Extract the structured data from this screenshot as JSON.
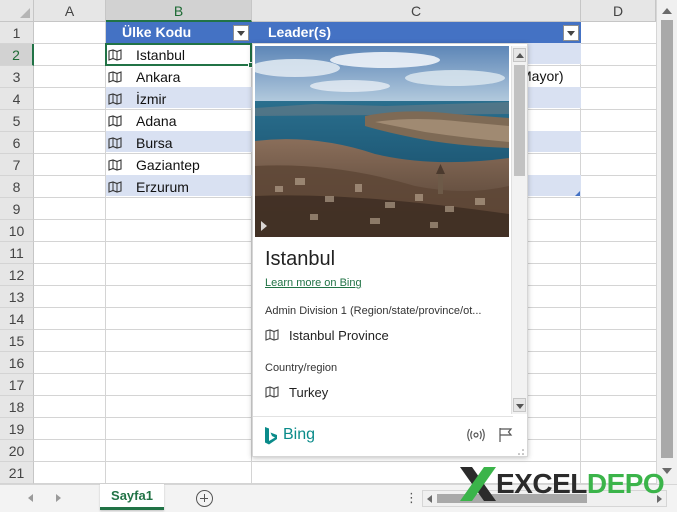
{
  "columns": [
    "A",
    "B",
    "C",
    "D"
  ],
  "rows": [
    "1",
    "2",
    "3",
    "4",
    "5",
    "6",
    "7",
    "8",
    "9",
    "10",
    "11",
    "12",
    "13",
    "14",
    "15",
    "16",
    "17",
    "18",
    "19",
    "20",
    "21"
  ],
  "table": {
    "header_b": "Ülke Kodu",
    "header_c": "Leader(s)",
    "cities": [
      "Istanbul",
      "Ankara",
      "İzmir",
      "Adana",
      "Bursa",
      "Gaziantep",
      "Erzurum"
    ],
    "clipped_c3": "Mayor)"
  },
  "card": {
    "title": "Istanbul",
    "learn_more": "Learn more on Bing",
    "field1_label": "Admin Division 1 (Region/state/province/ot...",
    "field1_value": "Istanbul Province",
    "field2_label": "Country/region",
    "field2_value": "Turkey",
    "brand": "Bing"
  },
  "sheet_tab": "Sayfa1",
  "watermark": {
    "part1": "EXCEL",
    "part2": "DEPO"
  },
  "colors": {
    "header_blue": "#4472c4",
    "band": "#d9e1f2",
    "excel_green": "#217346",
    "bing_teal": "#0a8b8a"
  },
  "icons": [
    "geography-map-icon",
    "bing-logo-icon",
    "broadcast-icon",
    "flag-icon",
    "add-sheet-icon"
  ]
}
